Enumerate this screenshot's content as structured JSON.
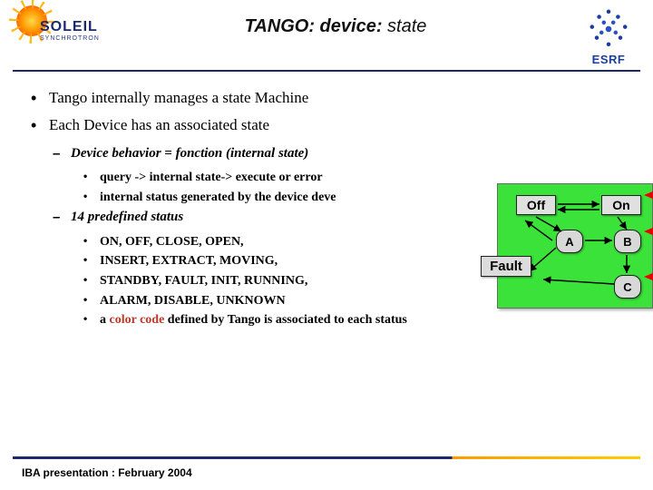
{
  "header": {
    "logo_left_word": "SOLEIL",
    "logo_left_sub": "SYNCHROTRON",
    "title_prefix": "TANGO: ",
    "title_bold": "device: ",
    "title_tail": "state",
    "logo_right": "ESRF"
  },
  "bullets": {
    "p1": "Tango internally manages a state Machine",
    "p2": "Each Device has an associated state",
    "sub1": "Device behavior = fonction (internal state)",
    "sub1a": "query -> internal state-> execute or error",
    "sub1b": "internal status generated by the device deve",
    "sub2": "14 predefined status",
    "states1": "ON, OFF, CLOSE, OPEN,",
    "states2": "INSERT, EXTRACT, MOVING,",
    "states3": "STANDBY, FAULT, INIT, RUNNING,",
    "states4": "ALARM, DISABLE, UNKNOWN",
    "colorcode_pre": "a ",
    "colorcode": "color code",
    "colorcode_post": " defined by Tango is associated to each status"
  },
  "diagram": {
    "off": "Off",
    "on": "On",
    "fault": "Fault",
    "A": "A",
    "B": "B",
    "C": "C"
  },
  "footer": "IBA presentation : February 2004"
}
